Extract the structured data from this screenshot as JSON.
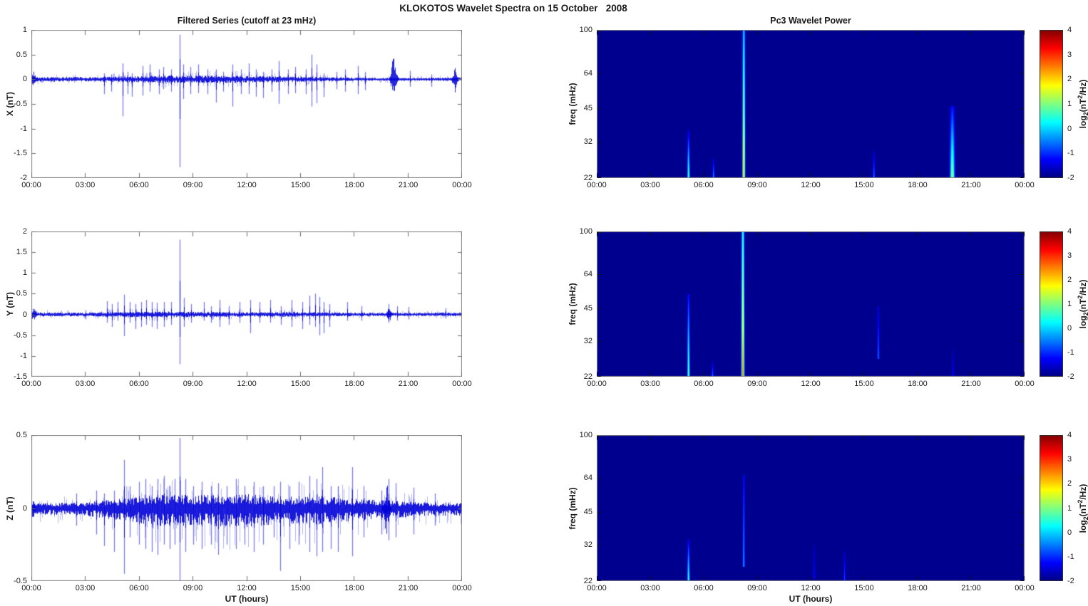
{
  "figure_title": "KLOKOTOS Wavelet Spectra on 15 October   2008",
  "colors": {
    "line": "#0000E0",
    "spectrogram_background": "#00008F",
    "axis_box": "#828282",
    "text": "#1a1a1a"
  },
  "time_axis": {
    "xlabel": "UT (hours)",
    "tick_labels": [
      "00:00",
      "03:00",
      "06:00",
      "09:00",
      "12:00",
      "15:00",
      "18:00",
      "21:00",
      "00:00"
    ],
    "range_hours": [
      0,
      24
    ]
  },
  "colorbar_label": {
    "base": "log",
    "sub": "2",
    "mid": "(nT",
    "sup": "2",
    "end": "/Hz)"
  },
  "chart_data": [
    {
      "type": "line",
      "series_name": "X filtered",
      "title": "Filtered Series (cutoff at 23 mHz)",
      "ylabel": "X (nT)",
      "xlabel": "",
      "x_range_hours": [
        0,
        24
      ],
      "x_tick_labels": [
        "00:00",
        "03:00",
        "06:00",
        "09:00",
        "12:00",
        "15:00",
        "18:00",
        "21:00",
        "00:00"
      ],
      "ylim": [
        -2,
        1
      ],
      "yticks": [
        1,
        0.5,
        0,
        -0.5,
        -1,
        -1.5,
        -2
      ],
      "grid": false,
      "noise_envelope_nT": [
        [
          0,
          0.04
        ],
        [
          3,
          0.035
        ],
        [
          5,
          0.045
        ],
        [
          7,
          0.06
        ],
        [
          9,
          0.055
        ],
        [
          11,
          0.06
        ],
        [
          13,
          0.05
        ],
        [
          15,
          0.04
        ],
        [
          16,
          0.035
        ],
        [
          18,
          0.025
        ],
        [
          20,
          0.025
        ],
        [
          22,
          0.022
        ],
        [
          24,
          0.03
        ]
      ],
      "down_bias": 1.0,
      "seed": 11,
      "spikes_t_up_down": [
        [
          4.05,
          0.12,
          -0.3
        ],
        [
          4.45,
          0.1,
          -0.25
        ],
        [
          5.1,
          0.32,
          -0.75
        ],
        [
          5.35,
          0.15,
          -0.3
        ],
        [
          5.6,
          0.12,
          -0.35
        ],
        [
          6.2,
          0.27,
          -0.33
        ],
        [
          6.6,
          0.3,
          -0.25
        ],
        [
          7.1,
          0.2,
          -0.3
        ],
        [
          7.35,
          0.25,
          -0.2
        ],
        [
          7.8,
          0.2,
          -0.25
        ],
        [
          8.25,
          0.9,
          -1.78
        ],
        [
          8.45,
          0.3,
          -0.4
        ],
        [
          8.85,
          0.25,
          -0.3
        ],
        [
          9.3,
          0.3,
          -0.28
        ],
        [
          9.8,
          0.2,
          -0.3
        ],
        [
          10.3,
          0.2,
          -0.47
        ],
        [
          10.7,
          0.15,
          -0.25
        ],
        [
          11.2,
          0.3,
          -0.55
        ],
        [
          11.7,
          0.2,
          -0.3
        ],
        [
          12.1,
          0.32,
          -0.3
        ],
        [
          12.5,
          0.2,
          -0.35
        ],
        [
          12.9,
          0.15,
          -0.38
        ],
        [
          13.4,
          0.2,
          -0.25
        ],
        [
          13.8,
          0.37,
          -0.5
        ],
        [
          14.3,
          0.2,
          -0.3
        ],
        [
          14.7,
          0.25,
          -0.28
        ],
        [
          15.3,
          0.2,
          -0.3
        ],
        [
          15.6,
          0.5,
          -0.55
        ],
        [
          15.9,
          0.3,
          -0.48
        ],
        [
          16.3,
          0.12,
          -0.36
        ],
        [
          17.0,
          0.15,
          -0.2
        ],
        [
          17.5,
          0.2,
          -0.25
        ],
        [
          18.2,
          0.27,
          -0.3
        ],
        [
          18.6,
          0.15,
          -0.22
        ],
        [
          21.1,
          0.17,
          -0.15
        ],
        [
          22.3,
          0.1,
          -0.15
        ]
      ],
      "bursts_t_dur_up_down": [
        [
          0.1,
          0.4,
          0.14,
          -0.14
        ],
        [
          20.2,
          0.5,
          0.55,
          -0.38
        ],
        [
          23.6,
          0.4,
          0.22,
          -0.25
        ]
      ]
    },
    {
      "type": "heatmap",
      "series_name": "X wavelet power",
      "title": "Pc3 Wavelet Power",
      "ylabel": "freq (mHz)",
      "xlabel": "",
      "yscale": "log",
      "ylim": [
        22,
        100
      ],
      "yticks": [
        100,
        64,
        45,
        32,
        22
      ],
      "x_range_hours": [
        0,
        24
      ],
      "x_tick_labels": [
        "00:00",
        "03:00",
        "06:00",
        "09:00",
        "12:00",
        "15:00",
        "18:00",
        "21:00",
        "00:00"
      ],
      "background_log2_power": -2,
      "colorbar": {
        "label": "log2(nT^2/Hz)",
        "range": [
          -2,
          4
        ],
        "ticks": [
          4,
          3,
          2,
          1,
          0,
          -1,
          -2
        ],
        "colormap": "jet"
      },
      "events": [
        {
          "t": 5.15,
          "f_lo": 22,
          "f_hi": 36,
          "peak": 0.9,
          "top": -1.5,
          "w": 1.2
        },
        {
          "t": 6.55,
          "f_lo": 22,
          "f_hi": 27,
          "peak": -0.3,
          "top": -1.6,
          "w": 1.0
        },
        {
          "t": 8.25,
          "f_lo": 22,
          "f_hi": 100,
          "peak": 2.3,
          "top": 0.0,
          "w": 1.3
        },
        {
          "t": 15.55,
          "f_lo": 22,
          "f_hi": 29,
          "peak": -0.5,
          "top": -1.6,
          "w": 1.0
        },
        {
          "t": 19.95,
          "f_lo": 22,
          "f_hi": 46,
          "peak": 1.3,
          "top": -1.2,
          "w": 2.2
        }
      ]
    },
    {
      "type": "line",
      "series_name": "Y filtered",
      "title": "",
      "ylabel": "Y (nT)",
      "xlabel": "",
      "x_range_hours": [
        0,
        24
      ],
      "x_tick_labels": [
        "00:00",
        "03:00",
        "06:00",
        "09:00",
        "12:00",
        "15:00",
        "18:00",
        "21:00",
        "00:00"
      ],
      "ylim": [
        -1.5,
        2
      ],
      "yticks": [
        2,
        1.5,
        1,
        0.5,
        0,
        -0.5,
        -1,
        -1.5
      ],
      "grid": false,
      "noise_envelope_nT": [
        [
          0,
          0.04
        ],
        [
          3,
          0.035
        ],
        [
          5,
          0.05
        ],
        [
          7,
          0.055
        ],
        [
          8.7,
          0.05
        ],
        [
          12,
          0.045
        ],
        [
          15,
          0.045
        ],
        [
          17,
          0.035
        ],
        [
          20,
          0.03
        ],
        [
          24,
          0.035
        ]
      ],
      "down_bias": 1.0,
      "seed": 22,
      "spikes_t_up_down": [
        [
          3.0,
          0.1,
          -0.12
        ],
        [
          4.2,
          0.32,
          -0.2
        ],
        [
          4.5,
          0.25,
          -0.3
        ],
        [
          4.8,
          0.3,
          -0.15
        ],
        [
          5.15,
          0.48,
          -0.52
        ],
        [
          5.5,
          0.3,
          -0.2
        ],
        [
          5.8,
          0.25,
          -0.35
        ],
        [
          6.1,
          0.3,
          -0.3
        ],
        [
          6.4,
          0.35,
          -0.25
        ],
        [
          6.7,
          0.3,
          -0.3
        ],
        [
          7.0,
          0.28,
          -0.35
        ],
        [
          7.4,
          0.3,
          -0.3
        ],
        [
          7.8,
          0.3,
          -0.25
        ],
        [
          8.25,
          1.8,
          -1.2
        ],
        [
          8.5,
          0.4,
          -0.3
        ],
        [
          8.9,
          0.25,
          -0.2
        ],
        [
          9.6,
          0.3,
          -0.15
        ],
        [
          10.0,
          0.2,
          -0.2
        ],
        [
          10.5,
          0.35,
          -0.3
        ],
        [
          11.0,
          0.2,
          -0.25
        ],
        [
          11.6,
          0.3,
          -0.2
        ],
        [
          12.2,
          0.35,
          -0.45
        ],
        [
          12.7,
          0.3,
          -0.2
        ],
        [
          13.3,
          0.35,
          -0.2
        ],
        [
          13.9,
          0.2,
          -0.25
        ],
        [
          14.5,
          0.35,
          -0.3
        ],
        [
          15.1,
          0.3,
          -0.35
        ],
        [
          15.5,
          0.45,
          -0.25
        ],
        [
          15.8,
          0.5,
          -0.3
        ],
        [
          16.05,
          0.42,
          -0.5
        ],
        [
          16.3,
          0.3,
          -0.45
        ],
        [
          16.6,
          0.25,
          -0.3
        ],
        [
          17.6,
          0.3,
          -0.15
        ],
        [
          18.4,
          0.2,
          -0.15
        ],
        [
          19.9,
          0.25,
          -0.2
        ],
        [
          20.4,
          0.2,
          -0.15
        ],
        [
          21.0,
          0.18,
          -0.12
        ],
        [
          23.1,
          0.15,
          -0.1
        ]
      ],
      "bursts_t_dur_up_down": [
        [
          0.1,
          0.4,
          0.16,
          -0.16
        ],
        [
          19.95,
          0.4,
          0.22,
          -0.18
        ]
      ]
    },
    {
      "type": "heatmap",
      "series_name": "Y wavelet power",
      "title": "",
      "ylabel": "freq (mHz)",
      "xlabel": "",
      "yscale": "log",
      "ylim": [
        22,
        100
      ],
      "yticks": [
        100,
        64,
        45,
        32,
        22
      ],
      "x_range_hours": [
        0,
        24
      ],
      "x_tick_labels": [
        "00:00",
        "03:00",
        "06:00",
        "09:00",
        "12:00",
        "15:00",
        "18:00",
        "21:00",
        "00:00"
      ],
      "background_log2_power": -2,
      "colorbar": {
        "label": "log2(nT^2/Hz)",
        "range": [
          -2,
          4
        ],
        "ticks": [
          4,
          3,
          2,
          1,
          0,
          -1,
          -2
        ],
        "colormap": "jet"
      },
      "events": [
        {
          "t": 5.15,
          "f_lo": 22,
          "f_hi": 52,
          "peak": 1.0,
          "top": -1.2,
          "w": 1.2
        },
        {
          "t": 6.5,
          "f_lo": 22,
          "f_hi": 26,
          "peak": -0.5,
          "top": -1.7,
          "w": 1.0
        },
        {
          "t": 8.2,
          "f_lo": 22,
          "f_hi": 100,
          "peak": 2.8,
          "top": 0.5,
          "w": 1.4
        },
        {
          "t": 15.8,
          "f_lo": 27,
          "f_hi": 46,
          "peak": -0.6,
          "top": -1.5,
          "w": 1.0
        },
        {
          "t": 20.0,
          "f_lo": 22,
          "f_hi": 30,
          "peak": -1.2,
          "top": -1.8,
          "w": 1.0
        }
      ]
    },
    {
      "type": "line",
      "series_name": "Z filtered",
      "title": "",
      "ylabel": "Z (nT)",
      "xlabel": "UT (hours)",
      "x_range_hours": [
        0,
        24
      ],
      "x_tick_labels": [
        "00:00",
        "03:00",
        "06:00",
        "09:00",
        "12:00",
        "15:00",
        "18:00",
        "21:00",
        "00:00"
      ],
      "ylim": [
        -0.5,
        0.5
      ],
      "yticks": [
        0.5,
        0,
        -0.5
      ],
      "grid": false,
      "noise_envelope_nT": [
        [
          0,
          0.025
        ],
        [
          3,
          0.03
        ],
        [
          5,
          0.05
        ],
        [
          7,
          0.07
        ],
        [
          9,
          0.07
        ],
        [
          12,
          0.075
        ],
        [
          14,
          0.06
        ],
        [
          16,
          0.065
        ],
        [
          18,
          0.05
        ],
        [
          20,
          0.04
        ],
        [
          22,
          0.03
        ],
        [
          24,
          0.03
        ]
      ],
      "down_bias": 1.35,
      "seed": 33,
      "spikes_t_up_down": [
        [
          2.5,
          0.1,
          -0.12
        ],
        [
          3.6,
          0.12,
          -0.18
        ],
        [
          4.05,
          0.1,
          -0.26
        ],
        [
          4.6,
          0.12,
          -0.3
        ],
        [
          5.15,
          0.33,
          -0.45
        ],
        [
          5.5,
          0.15,
          -0.2
        ],
        [
          6.0,
          0.18,
          -0.25
        ],
        [
          6.35,
          0.2,
          -0.28
        ],
        [
          6.7,
          0.15,
          -0.3
        ],
        [
          7.05,
          0.2,
          -0.32
        ],
        [
          7.4,
          0.22,
          -0.25
        ],
        [
          7.7,
          0.15,
          -0.28
        ],
        [
          8.0,
          0.2,
          -0.25
        ],
        [
          8.25,
          0.48,
          -0.52
        ],
        [
          8.6,
          0.2,
          -0.3
        ],
        [
          9.0,
          0.15,
          -0.25
        ],
        [
          9.5,
          0.18,
          -0.28
        ],
        [
          10.0,
          0.15,
          -0.25
        ],
        [
          10.4,
          0.17,
          -0.32
        ],
        [
          10.9,
          0.15,
          -0.25
        ],
        [
          11.4,
          0.2,
          -0.28
        ],
        [
          11.9,
          0.15,
          -0.25
        ],
        [
          12.4,
          0.18,
          -0.3
        ],
        [
          12.9,
          0.15,
          -0.25
        ],
        [
          13.5,
          0.15,
          -0.2
        ],
        [
          13.85,
          0.18,
          -0.43
        ],
        [
          14.4,
          0.15,
          -0.28
        ],
        [
          14.9,
          0.18,
          -0.25
        ],
        [
          15.5,
          0.22,
          -0.3
        ],
        [
          15.9,
          0.2,
          -0.33
        ],
        [
          16.2,
          0.28,
          -0.3
        ],
        [
          16.7,
          0.15,
          -0.28
        ],
        [
          17.1,
          0.15,
          -0.3
        ],
        [
          17.9,
          0.28,
          -0.33
        ],
        [
          18.5,
          0.15,
          -0.2
        ],
        [
          19.5,
          0.12,
          -0.18
        ],
        [
          19.9,
          0.2,
          -0.22
        ],
        [
          20.3,
          0.17,
          -0.2
        ],
        [
          21.3,
          0.14,
          -0.18
        ],
        [
          22.5,
          0.1,
          -0.12
        ]
      ],
      "bursts_t_dur_up_down": [
        [
          0.08,
          0.3,
          0.07,
          -0.07
        ],
        [
          19.8,
          0.5,
          0.18,
          -0.2
        ]
      ]
    },
    {
      "type": "heatmap",
      "series_name": "Z wavelet power",
      "title": "",
      "ylabel": "freq (mHz)",
      "xlabel": "UT (hours)",
      "yscale": "log",
      "ylim": [
        22,
        100
      ],
      "yticks": [
        100,
        64,
        45,
        32,
        22
      ],
      "x_range_hours": [
        0,
        24
      ],
      "x_tick_labels": [
        "00:00",
        "03:00",
        "06:00",
        "09:00",
        "12:00",
        "15:00",
        "18:00",
        "21:00",
        "00:00"
      ],
      "background_log2_power": -2,
      "colorbar": {
        "label": "log2(nT^2/Hz)",
        "range": [
          -2,
          4
        ],
        "ticks": [
          4,
          3,
          2,
          1,
          0,
          -1,
          -2
        ],
        "colormap": "jet"
      },
      "events": [
        {
          "t": 5.15,
          "f_lo": 22,
          "f_hi": 34,
          "peak": 0.7,
          "top": -1.4,
          "w": 1.2
        },
        {
          "t": 8.25,
          "f_lo": 26,
          "f_hi": 66,
          "peak": -0.2,
          "top": -1.2,
          "w": 1.0
        },
        {
          "t": 12.2,
          "f_lo": 23,
          "f_hi": 32,
          "peak": -1.2,
          "top": -1.7,
          "w": 1.0
        },
        {
          "t": 13.9,
          "f_lo": 22,
          "f_hi": 30,
          "peak": -0.8,
          "top": -1.6,
          "w": 1.0
        }
      ]
    }
  ]
}
